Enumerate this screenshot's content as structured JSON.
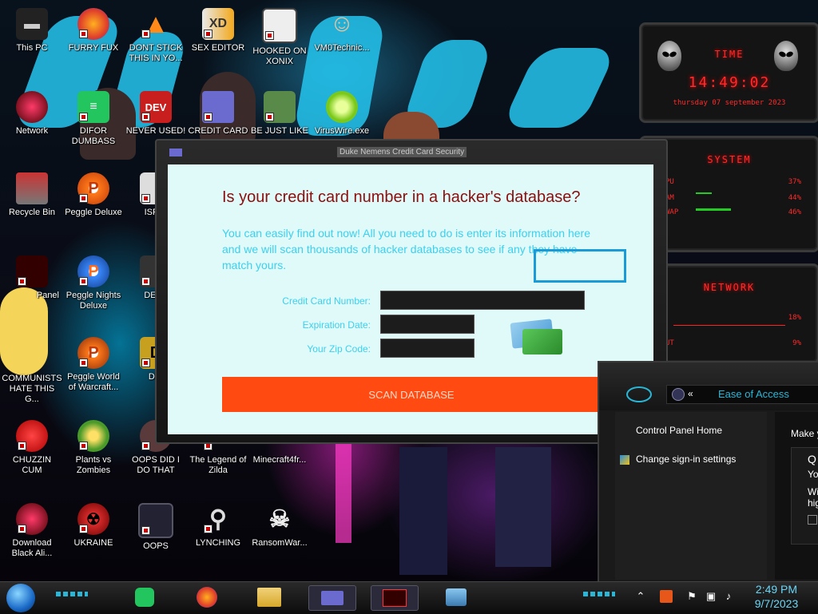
{
  "desktop": {
    "icons": [
      {
        "label": "This PC"
      },
      {
        "label": "FURRY FUX"
      },
      {
        "label": "DONT STICK THIS IN YO..."
      },
      {
        "label": "SEX EDITOR"
      },
      {
        "label": "HOOKED ON XONIX"
      },
      {
        "label": "VM0Technic..."
      },
      {
        "label": "Network"
      },
      {
        "label": "DIFOR DUMBASS"
      },
      {
        "label": "NEVER USED!"
      },
      {
        "label": "CREDIT CARD"
      },
      {
        "label": "BE JUST LIKE"
      },
      {
        "label": "VirusWire.exe"
      },
      {
        "label": "Recycle Bin"
      },
      {
        "label": "Peggle Deluxe"
      },
      {
        "label": "ISRAI"
      },
      {
        "label": "Panel"
      },
      {
        "label": "Peggle Nights Deluxe"
      },
      {
        "label": "DEEZ"
      },
      {
        "label": "COMMUNISTS HATE THIS G..."
      },
      {
        "label": "Peggle World of Warcraft..."
      },
      {
        "label": "DIE"
      },
      {
        "label": "CHUZZIN CUM"
      },
      {
        "label": "Plants vs Zombies"
      },
      {
        "label": "OOPS DID I DO THAT"
      },
      {
        "label": "The Legend of Zilda"
      },
      {
        "label": "Minecraft4fr..."
      },
      {
        "label": "Download Black Ali..."
      },
      {
        "label": "UKRAINE"
      },
      {
        "label": "OOPS"
      },
      {
        "label": "LYNCHING"
      },
      {
        "label": "RansomWar..."
      }
    ]
  },
  "widgets": {
    "time": {
      "title": "TIME",
      "clock": "14:49:02",
      "date": "thursday 07 september 2023"
    },
    "system": {
      "title": "SYSTEM",
      "rows": [
        {
          "label": "PU",
          "value": "37%"
        },
        {
          "label": "AM",
          "value": "44%"
        },
        {
          "label": "WAP",
          "value": "46%"
        }
      ]
    },
    "network": {
      "title": "NETWORK",
      "rows": [
        {
          "label": "",
          "value": "18%"
        },
        {
          "label": "UT",
          "value": "9%"
        }
      ]
    }
  },
  "scam_window": {
    "title": "Duke Nemens Credit Card Security",
    "headline": "Is your credit card number in a hacker's database?",
    "intro": "You can easily find out now! All you need to do is enter its information here and we will scan thousands of hacker databases to see if any they have match yours.",
    "fields": {
      "card_label": "Credit Card Number:",
      "card_value": "",
      "exp_label": "Expiration Date:",
      "exp_value": "",
      "zip_label": "Your Zip Code:",
      "zip_value": ""
    },
    "scan_button": "SCAN DATABASE"
  },
  "control_panel": {
    "breadcrumb_sep": "«",
    "breadcrumb": "Ease of Access",
    "nav": [
      "Control Panel Home",
      "Change sign-in settings"
    ],
    "right_partial": [
      "Make y",
      "Q",
      "Yo",
      "Wi",
      "hig"
    ]
  },
  "taskbar": {
    "time": "2:49 PM",
    "date": "9/7/2023"
  },
  "colors": {
    "headline": "#8b0f0f",
    "intro": "#3cd0f0",
    "scan_button": "#ff4a12",
    "dialog_bg": "#dffaf8",
    "widget_red": "#ff2a2a"
  }
}
